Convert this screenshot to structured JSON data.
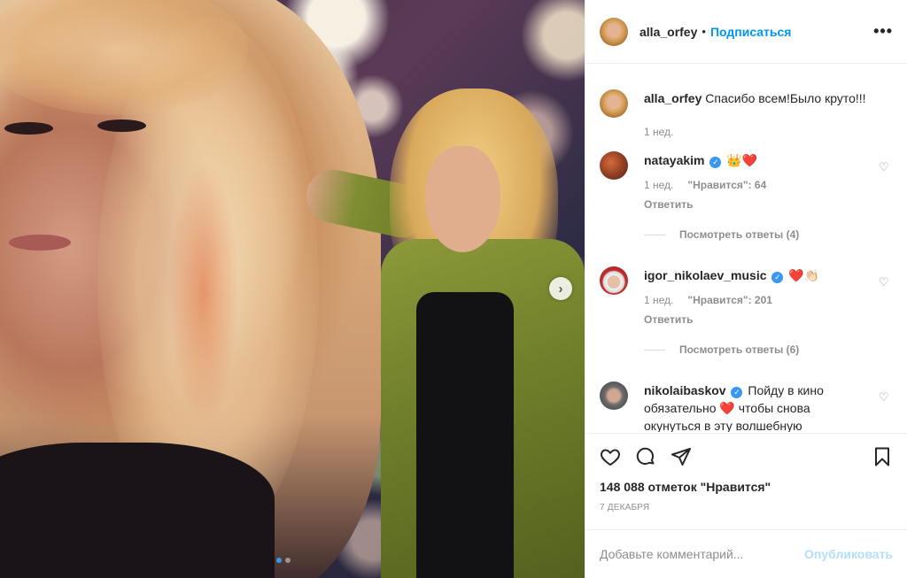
{
  "post": {
    "author": "alla_orfey",
    "separator": "•",
    "follow_label": "Подписаться",
    "more_label": "•••",
    "carousel_next": "›",
    "caption": {
      "username": "alla_orfey",
      "text": "Спасибо всем!Было круто!!!",
      "time": "1 нед."
    }
  },
  "comments": [
    {
      "username": "natayakim",
      "verified": true,
      "text": "👑❤️",
      "time": "1 нед.",
      "likes": "\"Нравится\": 64",
      "reply_label": "Ответить",
      "view_replies": "Посмотреть ответы (4)"
    },
    {
      "username": "igor_nikolaev_music",
      "verified": true,
      "text": "❤️👏🏻",
      "time": "1 нед.",
      "likes": "\"Нравится\": 201",
      "reply_label": "Ответить",
      "view_replies": "Посмотреть ответы (6)"
    },
    {
      "username": "nikolaibaskov",
      "verified": true,
      "text": "Пойду в кино обязательно ❤️ чтобы снова окунуться в эту волшебную атмосферу !!!"
    }
  ],
  "footer": {
    "likes": "148 088 отметок \"Нравится\"",
    "date": "7 декабря",
    "comment_placeholder": "Добавьте комментарий...",
    "publish_label": "Опубликовать"
  },
  "colors": {
    "link_blue": "#0095f6",
    "publish_disabled": "#b2dffc",
    "muted": "#8e8e8e"
  }
}
